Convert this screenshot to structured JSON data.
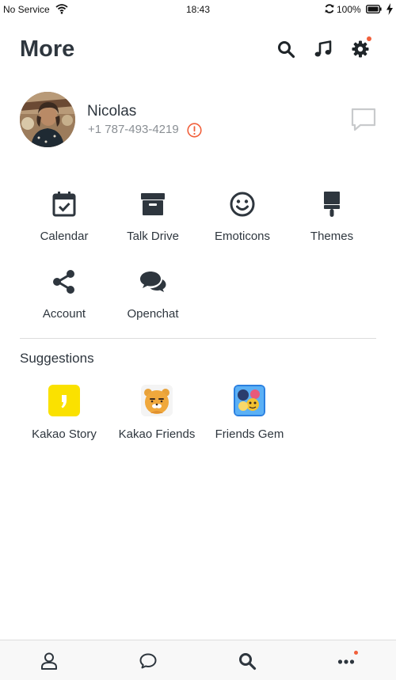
{
  "status_bar": {
    "carrier": "No Service",
    "time": "18:43",
    "battery": "100%"
  },
  "header": {
    "title": "More",
    "icons": [
      "search-icon",
      "music-note-icon",
      "gear-icon"
    ]
  },
  "profile": {
    "name": "Nicolas",
    "phone": "+1 787-493-4219"
  },
  "menu_items": [
    {
      "label": "Calendar",
      "icon": "calendar-check-icon"
    },
    {
      "label": "Talk Drive",
      "icon": "archive-box-icon"
    },
    {
      "label": "Emoticons",
      "icon": "smiley-icon"
    },
    {
      "label": "Themes",
      "icon": "paintbrush-icon"
    },
    {
      "label": "Account",
      "icon": "share-nodes-icon"
    },
    {
      "label": "Openchat",
      "icon": "chat-bubbles-icon"
    }
  ],
  "suggestions": {
    "title": "Suggestions",
    "items": [
      {
        "label": "Kakao Story"
      },
      {
        "label": "Kakao Friends"
      },
      {
        "label": "Friends Gem"
      }
    ]
  },
  "tab_bar": {
    "tabs": [
      "person-icon",
      "chat-bubble-icon",
      "search-icon",
      "more-dots-icon"
    ]
  },
  "colors": {
    "text": "#2e363e",
    "secondary_text": "#8a8f94",
    "notification_dot": "#f1603b",
    "kakao_yellow": "#fae100"
  }
}
